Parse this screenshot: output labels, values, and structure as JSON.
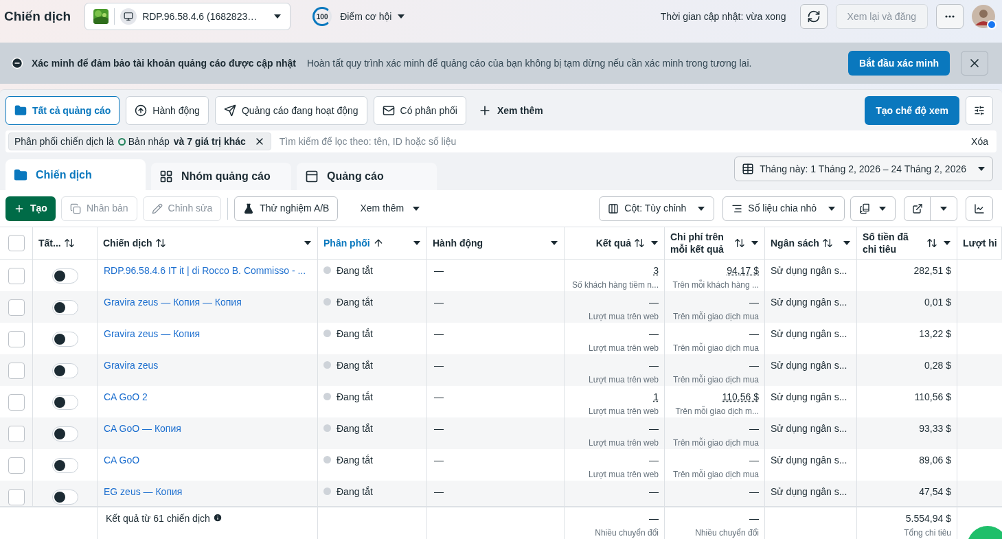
{
  "header": {
    "title": "Chiến dịch",
    "account": "RDP.96.58.4.6 (1682823…",
    "score": "100",
    "score_label": "Điểm cơ hội",
    "updated": "Thời gian cập nhật: vừa xong",
    "review_button": "Xem lại và đăng"
  },
  "banner": {
    "title": "Xác minh để đảm bảo tài khoản quảng cáo được cập nhật",
    "message": "Hoàn tất quy trình xác minh để quảng cáo của bạn không bị tạm dừng nếu cần xác minh trong tương lai.",
    "button": "Bắt đầu xác minh"
  },
  "view_tabs": [
    {
      "label": "Tất cả quảng cáo",
      "kind": "folder",
      "selected": true
    },
    {
      "label": "Hành động",
      "kind": "action",
      "selected": false
    },
    {
      "label": "Quảng cáo đang hoạt động",
      "kind": "send",
      "selected": false
    },
    {
      "label": "Có phân phối",
      "kind": "mail",
      "selected": false
    }
  ],
  "more_views": "Xem thêm",
  "create_view": "Tạo chế độ xem",
  "filter": {
    "prefix": "Phân phối chiến dịch là",
    "value": "Bản nháp",
    "suffix": "và 7 giá trị khác",
    "placeholder": "Tìm kiếm để lọc theo: tên, ID hoặc số liệu",
    "clear": "Xóa"
  },
  "level_tabs": [
    {
      "label": "Chiến dịch",
      "kind": "campaign",
      "selected": true
    },
    {
      "label": "Nhóm quảng cáo",
      "kind": "adset",
      "selected": false
    },
    {
      "label": "Quảng cáo",
      "kind": "ad",
      "selected": false
    }
  ],
  "date_range": "Tháng này: 1 Tháng 2, 2026 – 24 Tháng 2, 2026",
  "toolbar": {
    "create": "Tạo",
    "duplicate": {
      "label": "Nhân bản",
      "disabled": true
    },
    "edit": {
      "label": "Chỉnh sửa",
      "disabled": true
    },
    "ab_test": "Thử nghiệm A/B",
    "more": "Xem thêm",
    "columns": "Cột: Tùy chỉnh",
    "breakdown": "Số liệu chia nhỏ"
  },
  "select_all": {
    "checked": false
  },
  "columns": [
    {
      "label": "Tất...",
      "kind": "toggle"
    },
    {
      "label": "Chiến dịch",
      "kind": "text"
    },
    {
      "label": "Phân phối",
      "kind": "sorted"
    },
    {
      "label": "Hành động",
      "kind": "plain"
    },
    {
      "label": "Kết quả",
      "kind": "number"
    },
    {
      "label": "Chi phí trên mỗi kết quả",
      "kind": "metric"
    },
    {
      "label": "Ngân sách",
      "kind": "text"
    },
    {
      "label": "Số tiền đã chi tiêu",
      "kind": "metric"
    },
    {
      "label": "Lượt hi",
      "kind": "cut"
    }
  ],
  "rows": [
    {
      "checked": false,
      "on": false,
      "name": "RDP.96.58.4.6 IT it | di Rocco B. Commisso - ...",
      "delivery": "Đang tắt",
      "action": "—",
      "result": "3",
      "result_note": "Số khách hàng tiềm n...",
      "cpr": "94,17 $",
      "cpr_note": "Trên mỗi khách hàng ...",
      "has_link": true,
      "budget": "Sử dụng ngân s...",
      "spent": "282,51 $"
    },
    {
      "checked": false,
      "on": false,
      "name": "Gravira zeus — Копия — Копия",
      "delivery": "Đang tắt",
      "action": "—",
      "result": "—",
      "result_note": "Lượt mua trên web",
      "cpr": "—",
      "cpr_note": "Trên mỗi giao dịch mua",
      "has_link": false,
      "budget": "Sử dụng ngân s...",
      "spent": "0,01 $"
    },
    {
      "checked": false,
      "on": false,
      "name": "Gravira zeus — Копия",
      "delivery": "Đang tắt",
      "action": "—",
      "result": "—",
      "result_note": "Lượt mua trên web",
      "cpr": "—",
      "cpr_note": "Trên mỗi giao dịch mua",
      "has_link": false,
      "budget": "Sử dụng ngân s...",
      "spent": "13,22 $"
    },
    {
      "checked": false,
      "on": false,
      "name": "Gravira zeus",
      "delivery": "Đang tắt",
      "action": "—",
      "result": "—",
      "result_note": "Lượt mua trên web",
      "cpr": "—",
      "cpr_note": "Trên mỗi giao dịch mua",
      "has_link": false,
      "budget": "Sử dụng ngân s...",
      "spent": "0,28 $"
    },
    {
      "checked": false,
      "on": false,
      "name": "CA GoO 2",
      "delivery": "Đang tắt",
      "action": "—",
      "result": "1",
      "result_note": "Lượt mua trên web",
      "cpr": "110,56 $",
      "cpr_note": "Trên mỗi giao dịch m...",
      "has_link": true,
      "budget": "Sử dụng ngân s...",
      "spent": "110,56 $"
    },
    {
      "checked": false,
      "on": false,
      "name": "CA GoO — Копия",
      "delivery": "Đang tắt",
      "action": "—",
      "result": "—",
      "result_note": "Lượt mua trên web",
      "cpr": "—",
      "cpr_note": "Trên mỗi giao dịch mua",
      "has_link": false,
      "budget": "Sử dụng ngân s...",
      "spent": "93,33 $"
    },
    {
      "checked": false,
      "on": false,
      "name": "CA GoO",
      "delivery": "Đang tắt",
      "action": "—",
      "result": "—",
      "result_note": "Lượt mua trên web",
      "cpr": "—",
      "cpr_note": "Trên mỗi giao dịch mua",
      "has_link": false,
      "budget": "Sử dụng ngân s...",
      "spent": "89,06 $"
    },
    {
      "checked": false,
      "on": false,
      "name": "EG zeus — Копия",
      "delivery": "Đang tắt",
      "action": "—",
      "result": "—",
      "cpr": "—",
      "has_link": false,
      "budget": "Sử dụng ngân s...",
      "spent": "47,54 $"
    }
  ],
  "footer": {
    "summary": "Kết quả từ 61 chiến dịch",
    "result": "—",
    "result_note": "Nhiều chuyển đổi",
    "cpr": "—",
    "cpr_note": "Nhiều chuyển đổi",
    "spent": "5.554,94 $",
    "spent_note": "Tổng chi tiêu"
  }
}
